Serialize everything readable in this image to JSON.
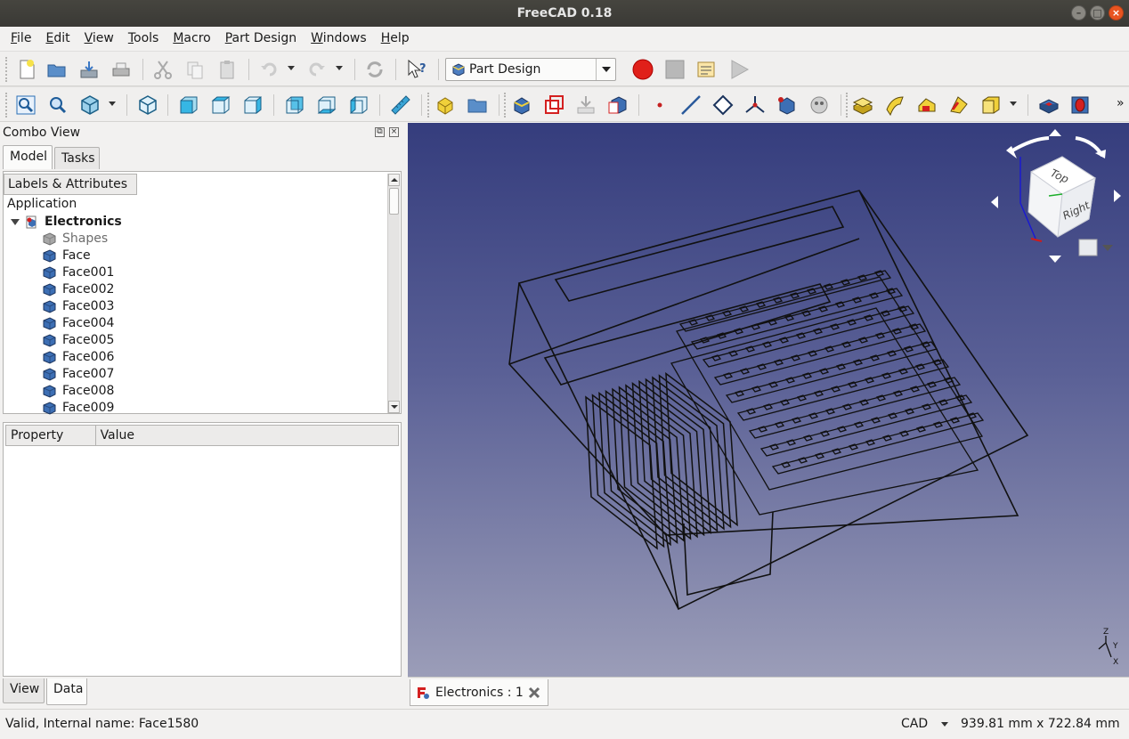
{
  "window": {
    "title": "FreeCAD 0.18"
  },
  "menubar": {
    "items": [
      {
        "label": "File",
        "u": "F",
        "rest": "ile"
      },
      {
        "label": "Edit",
        "u": "E",
        "rest": "dit"
      },
      {
        "label": "View",
        "u": "V",
        "rest": "iew"
      },
      {
        "label": "Tools",
        "u": "T",
        "rest": "ools"
      },
      {
        "label": "Macro",
        "u": "M",
        "rest": "acro"
      },
      {
        "label": "Part Design",
        "u": "P",
        "rest": "art Design"
      },
      {
        "label": "Windows",
        "u": "W",
        "rest": "indows"
      },
      {
        "label": "Help",
        "u": "H",
        "rest": "elp"
      }
    ]
  },
  "toolbar": {
    "workbench": "Part Design"
  },
  "combo": {
    "title": "Combo View",
    "tabs": [
      "Model",
      "Tasks"
    ],
    "tree_header": "Labels & Attributes",
    "application": "Application",
    "document": "Electronics",
    "items": [
      "Shapes",
      "Face",
      "Face001",
      "Face002",
      "Face003",
      "Face004",
      "Face005",
      "Face006",
      "Face007",
      "Face008",
      "Face009"
    ],
    "prop_headers": [
      "Property",
      "Value"
    ],
    "bottom_tabs": [
      "View",
      "Data"
    ]
  },
  "navcube": {
    "top": "Top",
    "right": "Right"
  },
  "axes": {
    "x": "X",
    "y": "Y",
    "z": "Z"
  },
  "doc_tab": {
    "label": "Electronics : 1"
  },
  "status": {
    "message": "Valid, Internal name: Face1580",
    "nav_style": "CAD",
    "dimensions": "939.81 mm x 722.84 mm"
  },
  "colors": {
    "view_top": "#353d7d",
    "view_bottom": "#9b9db8",
    "accent_red": "#e0201a",
    "ubuntu_orange": "#e95420"
  }
}
